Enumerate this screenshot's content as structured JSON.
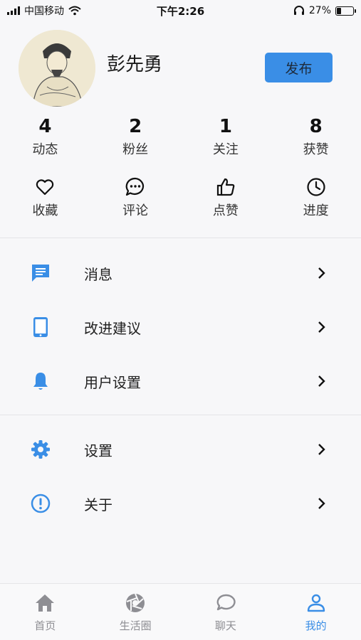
{
  "status_bar": {
    "carrier": "中国移动",
    "time": "下午2:26",
    "battery": "27%",
    "battery_level": 0.27
  },
  "profile": {
    "username": "彭先勇",
    "publish_label": "发布"
  },
  "stats": [
    {
      "value": "4",
      "label": "动态"
    },
    {
      "value": "2",
      "label": "粉丝"
    },
    {
      "value": "1",
      "label": "关注"
    },
    {
      "value": "8",
      "label": "获赞"
    }
  ],
  "quick_actions": [
    {
      "label": "收藏",
      "icon": "heart-icon"
    },
    {
      "label": "评论",
      "icon": "comment-icon"
    },
    {
      "label": "点赞",
      "icon": "thumbs-up-icon"
    },
    {
      "label": "进度",
      "icon": "clock-icon"
    }
  ],
  "menu_group_1": [
    {
      "label": "消息",
      "icon": "message-icon"
    },
    {
      "label": "改进建议",
      "icon": "tablet-icon"
    },
    {
      "label": "用户设置",
      "icon": "bell-icon"
    }
  ],
  "menu_group_2": [
    {
      "label": "设置",
      "icon": "gear-icon"
    },
    {
      "label": "关于",
      "icon": "info-circle-icon"
    }
  ],
  "tabs": [
    {
      "label": "首页",
      "icon": "home-icon"
    },
    {
      "label": "生活圈",
      "icon": "aperture-icon"
    },
    {
      "label": "聊天",
      "icon": "chat-bubble-icon"
    },
    {
      "label": "我的",
      "icon": "person-icon",
      "active": true
    }
  ],
  "colors": {
    "accent": "#3a8ee6",
    "tab_inactive": "#8e8e93",
    "background": "#f7f7f9"
  }
}
